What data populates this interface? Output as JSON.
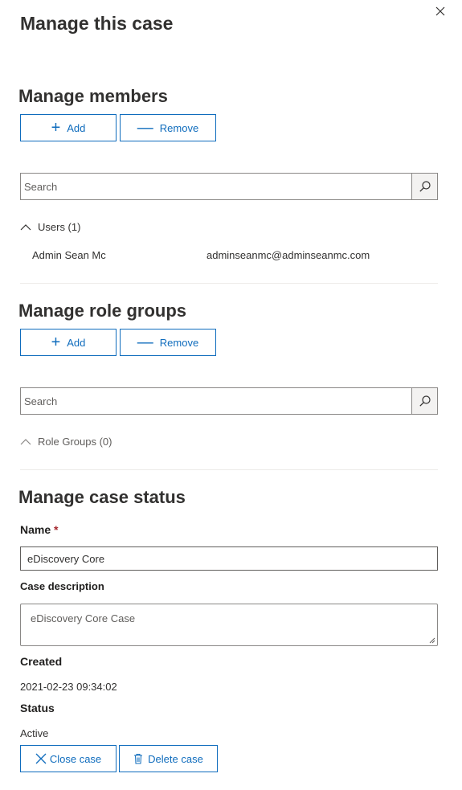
{
  "panel": {
    "title": "Manage this case",
    "close_icon": "close-icon"
  },
  "members": {
    "heading": "Manage members",
    "add_label": "Add",
    "remove_label": "Remove",
    "search_placeholder": "Search",
    "group_label": "Users (1)",
    "users": [
      {
        "name": "Admin Sean Mc",
        "email": "adminseanmc@adminseanmc.com"
      }
    ]
  },
  "role_groups": {
    "heading": "Manage role groups",
    "add_label": "Add",
    "remove_label": "Remove",
    "search_placeholder": "Search",
    "group_label": "Role Groups (0)"
  },
  "case_status": {
    "heading": "Manage case status",
    "name_label": "Name",
    "required_mark": "*",
    "name_value": "eDiscovery Core",
    "description_label": "Case description",
    "description_value": "eDiscovery Core Case",
    "created_label": "Created",
    "created_value": "2021-02-23 09:34:02",
    "status_label": "Status",
    "status_value": "Active",
    "close_case_label": "Close case",
    "delete_case_label": "Delete case"
  },
  "colors": {
    "accent": "#0f6cbd",
    "required": "#a4262c"
  }
}
